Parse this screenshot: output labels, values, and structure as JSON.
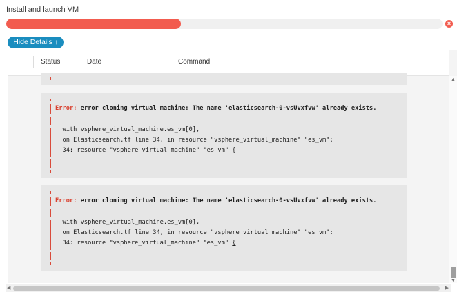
{
  "window": {
    "title": "Install and launch VM"
  },
  "progress": {
    "value_percent": 40,
    "color": "#f25c4f",
    "cancel_icon": "close-icon",
    "cancel_glyph": "×"
  },
  "details_toggle": {
    "label": "Hide Details",
    "icon": "arrow-up-icon",
    "glyph": "↑",
    "color": "#1a8dbf"
  },
  "table": {
    "columns": [
      "Status",
      "Date",
      "Command"
    ]
  },
  "log": {
    "entries": [
      {
        "error_label": "Error:",
        "error_message": "error cloning virtual machine: The name 'elasticsearch-0-vsUvxfvw' already exists.",
        "detail_lines": [
          "  with vsphere_virtual_machine.es_vm[0],",
          "  on Elasticsearch.tf line 34, in resource \"vsphere_virtual_machine\" \"es_vm\":",
          "  34: resource \"vsphere_virtual_machine\" \"es_vm\" "
        ],
        "cursor_char": "{"
      },
      {
        "error_label": "Error:",
        "error_message": "error cloning virtual machine: The name 'elasticsearch-0-vsUvxfvw' already exists.",
        "detail_lines": [
          "  with vsphere_virtual_machine.es_vm[0],",
          "  on Elasticsearch.tf line 34, in resource \"vsphere_virtual_machine\" \"es_vm\":",
          "  34: resource \"vsphere_virtual_machine\" \"es_vm\" "
        ],
        "cursor_char": "{"
      }
    ]
  },
  "scrollbars": {
    "up_glyph": "▲",
    "down_glyph": "▼",
    "left_glyph": "◀",
    "right_glyph": "▶"
  }
}
